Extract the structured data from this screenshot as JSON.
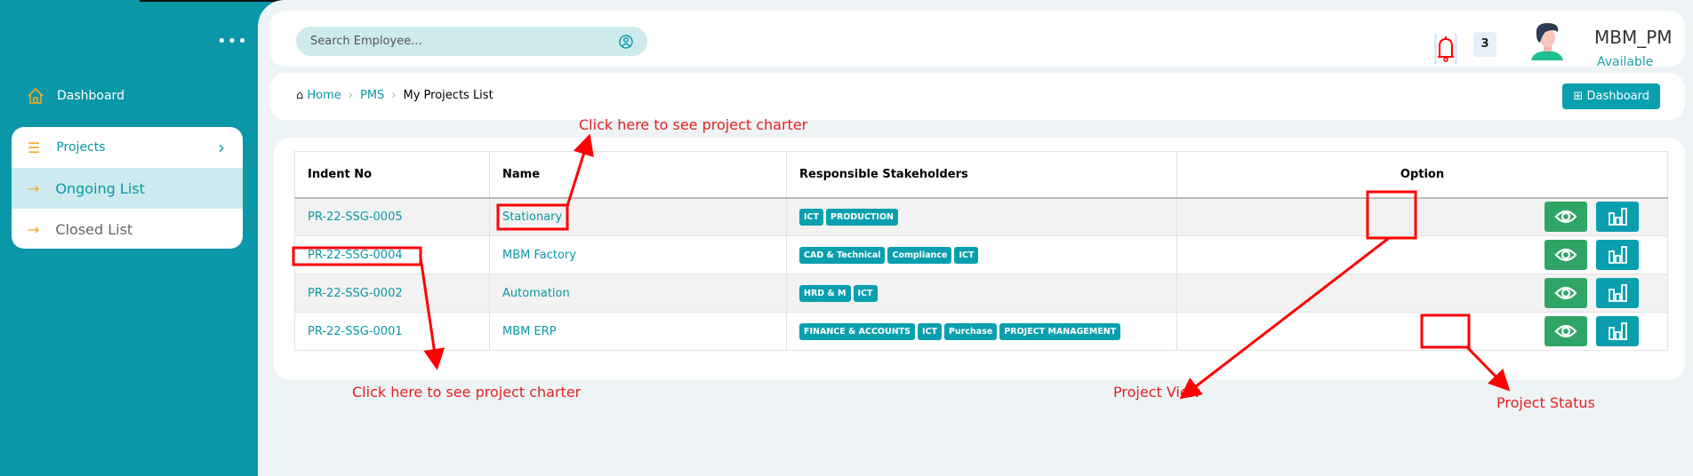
{
  "sidebar": {
    "dashboard": "Dashboard",
    "projects": "Projects",
    "ongoing": "Ongoing List",
    "closed": "Closed List"
  },
  "header": {
    "search_placeholder": "Search Employee...",
    "notifications": "3",
    "user": "MBM_PM",
    "status": "Available"
  },
  "breadcrumb": {
    "home": "Home",
    "pms": "PMS",
    "current": "My Projects List",
    "dashboard_button": "Dashboard"
  },
  "table": {
    "headers": [
      "Indent No",
      "Name",
      "Responsible Stakeholders",
      "Option"
    ],
    "rows": [
      {
        "indent": "PR-22-SSG-0005",
        "name": "Stationary",
        "tags": [
          "ICT",
          "PRODUCTION"
        ]
      },
      {
        "indent": "PR-22-SSG-0004",
        "name": "MBM Factory",
        "tags": [
          "CAD & Technical",
          "Compliance",
          "ICT"
        ]
      },
      {
        "indent": "PR-22-SSG-0002",
        "name": "Automation",
        "tags": [
          "HRD & M",
          "ICT"
        ]
      },
      {
        "indent": "PR-22-SSG-0001",
        "name": "MBM ERP",
        "tags": [
          "FINANCE & ACCOUNTS",
          "ICT",
          "Purchase",
          "PROJECT MANAGEMENT"
        ]
      }
    ]
  },
  "annotations": {
    "charter_top": "Click here to see project charter",
    "charter_bottom": "Click here to see project charter",
    "view": "Project View",
    "status": "Project Status"
  }
}
